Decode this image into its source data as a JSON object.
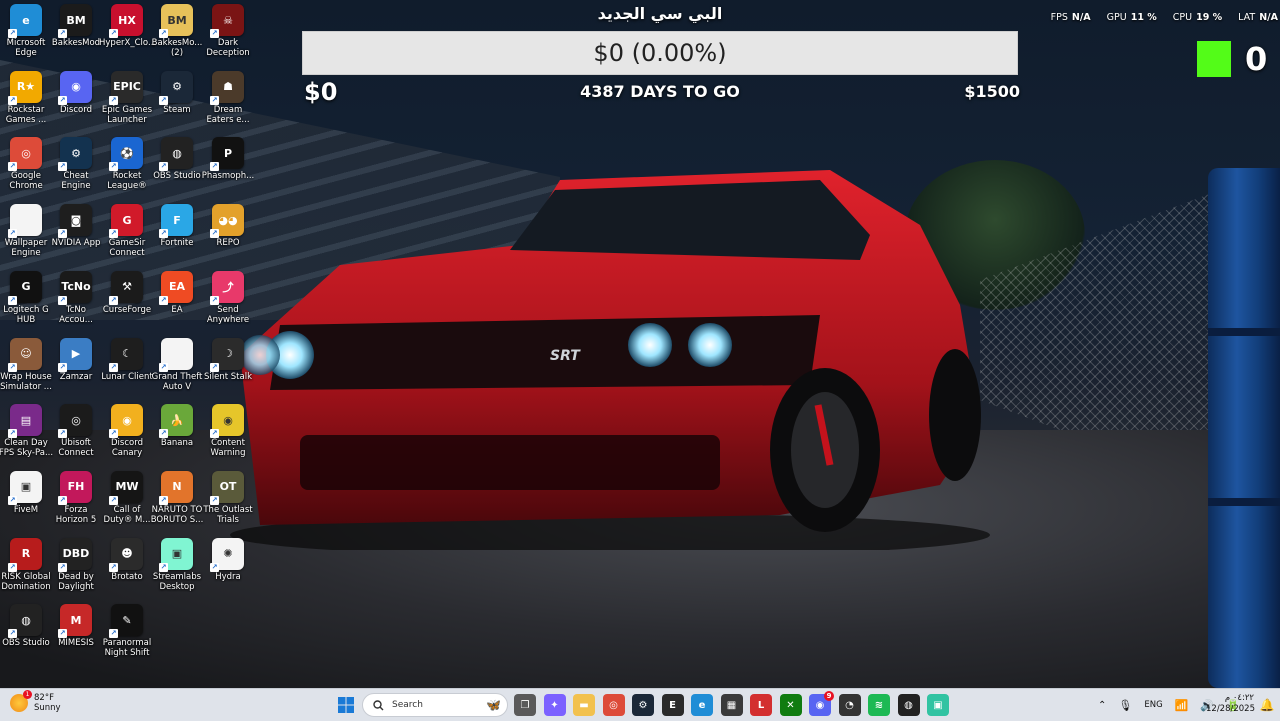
{
  "desktop": {
    "icons": [
      {
        "label": "Microsoft Edge",
        "icon": "edge-icon",
        "color": "#1f8dd6",
        "glyph": "e"
      },
      {
        "label": "BakkesMod",
        "icon": "bakkesmod-icon",
        "color": "#1b1b1b",
        "glyph": "BM"
      },
      {
        "label": "HyperX_Clo...",
        "icon": "hyperx-icon",
        "color": "#c8102e",
        "glyph": "HX"
      },
      {
        "label": "BakkesMo... (2)",
        "icon": "folder-icon",
        "color": "#e7c15a",
        "glyph": "BM"
      },
      {
        "label": "Dark Deception",
        "icon": "dark-deception-icon",
        "color": "#7a1414",
        "glyph": "☠"
      },
      {
        "label": "Rockstar Games ...",
        "icon": "rockstar-icon",
        "color": "#f2a900",
        "glyph": "R★"
      },
      {
        "label": "Discord",
        "icon": "discord-icon",
        "color": "#5865f2",
        "glyph": "◉"
      },
      {
        "label": "Epic Games Launcher",
        "icon": "epic-games-icon",
        "color": "#2a2a2a",
        "glyph": "EPIC"
      },
      {
        "label": "Steam",
        "icon": "steam-icon",
        "color": "#1b2838",
        "glyph": "⚙"
      },
      {
        "label": "Dream Eaters e...",
        "icon": "dream-eaters-icon",
        "color": "#4b3a2a",
        "glyph": "☗"
      },
      {
        "label": "Google Chrome",
        "icon": "chrome-icon",
        "color": "#dd4b39",
        "glyph": "◎"
      },
      {
        "label": "Cheat Engine",
        "icon": "cheat-engine-icon",
        "color": "#13324f",
        "glyph": "⚙"
      },
      {
        "label": "Rocket League®",
        "icon": "rocket-league-icon",
        "color": "#1a66d1",
        "glyph": "⚽"
      },
      {
        "label": "OBS Studio",
        "icon": "obs-icon",
        "color": "#222",
        "glyph": "◍"
      },
      {
        "label": "Phasmoph...",
        "icon": "phasmophobia-icon",
        "color": "#111",
        "glyph": "P"
      },
      {
        "label": "Wallpaper Engine",
        "icon": "file-icon",
        "color": "#f4f4f4",
        "glyph": ""
      },
      {
        "label": "NVIDIA App",
        "icon": "nvidia-icon",
        "color": "#1e1e1e",
        "glyph": "◙"
      },
      {
        "label": "GameSir Connect",
        "icon": "gamesir-icon",
        "color": "#d11a2a",
        "glyph": "G"
      },
      {
        "label": "Fortnite",
        "icon": "fortnite-icon",
        "color": "#2aa7e6",
        "glyph": "F"
      },
      {
        "label": "REPO",
        "icon": "repo-icon",
        "color": "#e3a12b",
        "glyph": "◕◕"
      },
      {
        "label": "Logitech G HUB",
        "icon": "logitech-icon",
        "color": "#111",
        "glyph": "G"
      },
      {
        "label": "TcNo Accou...",
        "icon": "tcno-icon",
        "color": "#1a1a1a",
        "glyph": "TcNo"
      },
      {
        "label": "CurseForge",
        "icon": "curseforge-icon",
        "color": "#1b1b1b",
        "glyph": "⚒"
      },
      {
        "label": "EA",
        "icon": "ea-icon",
        "color": "#ef4b23",
        "glyph": "EA"
      },
      {
        "label": "Send Anywhere",
        "icon": "send-anywhere-icon",
        "color": "#e8396a",
        "glyph": "⤴"
      },
      {
        "label": "Wrap House Simulator ...",
        "icon": "wrap-house-icon",
        "color": "#8a5a3a",
        "glyph": "☺"
      },
      {
        "label": "Zamzar",
        "icon": "zamzar-icon",
        "color": "#3b7dc4",
        "glyph": "▶"
      },
      {
        "label": "Lunar Client",
        "icon": "lunar-client-icon",
        "color": "#1e1e1e",
        "glyph": "☾"
      },
      {
        "label": "Grand Theft Auto V",
        "icon": "file-icon",
        "color": "#f4f4f4",
        "glyph": ""
      },
      {
        "label": "Silent Stalk",
        "icon": "silent-stalk-icon",
        "color": "#2b2b2b",
        "glyph": "☽"
      },
      {
        "label": "Clean Day FPS Sky-Pa...",
        "icon": "winrar-icon",
        "color": "#7a2a8a",
        "glyph": "▤"
      },
      {
        "label": "Ubisoft Connect",
        "icon": "ubisoft-icon",
        "color": "#1b1b1b",
        "glyph": "◎"
      },
      {
        "label": "Discord Canary",
        "icon": "discord-canary-icon",
        "color": "#f2b01e",
        "glyph": "◉"
      },
      {
        "label": "Banana",
        "icon": "banana-icon",
        "color": "#6aa83a",
        "glyph": "🍌"
      },
      {
        "label": "Content Warning",
        "icon": "content-warning-icon",
        "color": "#e6c62a",
        "glyph": "◉"
      },
      {
        "label": "FiveM",
        "icon": "fivem-icon",
        "color": "#f4f4f4",
        "glyph": "▣"
      },
      {
        "label": "Forza Horizon 5",
        "icon": "forza-icon",
        "color": "#c2185b",
        "glyph": "FH"
      },
      {
        "label": "Call of Duty® M...",
        "icon": "cod-icon",
        "color": "#151515",
        "glyph": "MW"
      },
      {
        "label": "NARUTO TO BORUTO S...",
        "icon": "naruto-icon",
        "color": "#e2742b",
        "glyph": "N"
      },
      {
        "label": "The Outlast Trials",
        "icon": "outlast-icon",
        "color": "#5a5a3a",
        "glyph": "OT"
      },
      {
        "label": "RISK Global Domination",
        "icon": "risk-icon",
        "color": "#b71c1c",
        "glyph": "R"
      },
      {
        "label": "Dead by Daylight",
        "icon": "dbd-icon",
        "color": "#222",
        "glyph": "DBD"
      },
      {
        "label": "Brotato",
        "icon": "brotato-icon",
        "color": "#2b2b2b",
        "glyph": "☻"
      },
      {
        "label": "Streamlabs Desktop",
        "icon": "streamlabs-icon",
        "color": "#80f5d2",
        "glyph": "▣"
      },
      {
        "label": "Hydra",
        "icon": "hydra-icon",
        "color": "#f4f4f4",
        "glyph": "✺"
      },
      {
        "label": "OBS Studio",
        "icon": "obs-icon",
        "color": "#222",
        "glyph": "◍"
      },
      {
        "label": "MIMESIS",
        "icon": "mimesis-icon",
        "color": "#c62828",
        "glyph": "M"
      },
      {
        "label": "Paranormal Night Shift",
        "icon": "paranormal-icon",
        "color": "#111",
        "glyph": "✎"
      }
    ]
  },
  "goal": {
    "title": "البي سي الجديد",
    "bar_text": "$0 (0.00%)",
    "progress_fraction": 0.0,
    "min_label": "$0",
    "days_label": "4387 DAYS TO GO",
    "max_label": "$1500"
  },
  "stats": {
    "fps_label": "FPS",
    "fps_value": "N/A",
    "gpu_label": "GPU",
    "gpu_value": "11 %",
    "cpu_label": "CPU",
    "cpu_value": "19 %",
    "lat_label": "LAT",
    "lat_value": "N/A"
  },
  "kick": {
    "count": "0",
    "color": "#53fc18"
  },
  "taskbar": {
    "weather_temp": "82°F",
    "weather_desc": "Sunny",
    "weather_badge": "1",
    "search_placeholder": "Search",
    "pinned": [
      {
        "name": "task-view",
        "icon": "task-view-icon",
        "color": "#5a5a5a",
        "glyph": "❐"
      },
      {
        "name": "copilot",
        "icon": "copilot-icon",
        "color": "#7b61ff",
        "glyph": "✦"
      },
      {
        "name": "file-explorer",
        "icon": "folder-icon",
        "color": "#f2c14e",
        "glyph": "▬"
      },
      {
        "name": "chrome",
        "icon": "chrome-icon",
        "color": "#dd4b39",
        "glyph": "◎"
      },
      {
        "name": "steam",
        "icon": "steam-icon",
        "color": "#1b2838",
        "glyph": "⚙"
      },
      {
        "name": "epic-games",
        "icon": "epic-games-icon",
        "color": "#2a2a2a",
        "glyph": "E"
      },
      {
        "name": "edge",
        "icon": "edge-icon",
        "color": "#1f8dd6",
        "glyph": "e"
      },
      {
        "name": "store",
        "icon": "store-icon",
        "color": "#3a3a3a",
        "glyph": "▦"
      },
      {
        "name": "app-l",
        "icon": "l-icon",
        "color": "#d32f2f",
        "glyph": "L"
      },
      {
        "name": "xbox",
        "icon": "xbox-icon",
        "color": "#107c10",
        "glyph": "✕"
      },
      {
        "name": "discord",
        "icon": "discord-icon",
        "color": "#5865f2",
        "glyph": "◉"
      },
      {
        "name": "speedtest",
        "icon": "speedtest-icon",
        "color": "#333",
        "glyph": "◔"
      },
      {
        "name": "spotify",
        "icon": "spotify-icon",
        "color": "#1db954",
        "glyph": "≋"
      },
      {
        "name": "obs",
        "icon": "obs-icon",
        "color": "#222",
        "glyph": "◍"
      },
      {
        "name": "streamlabs",
        "icon": "streamlabs-icon",
        "color": "#31c3a2",
        "glyph": "▣"
      }
    ],
    "discord_badge": "9",
    "language": "ENG",
    "time": "٠٤:٢٢ م",
    "date": "12/28/2025"
  }
}
